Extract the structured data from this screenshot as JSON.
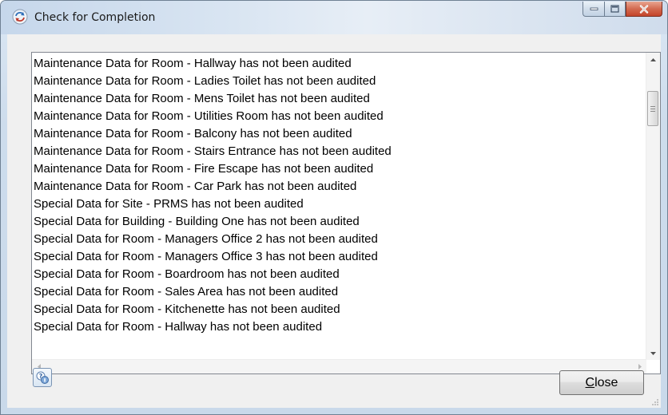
{
  "window": {
    "title": "Check for Completion",
    "title_icon": "refresh-cycle-icon",
    "caption_buttons": [
      "minimize-icon",
      "maximize-icon",
      "close-icon"
    ]
  },
  "messages": [
    "Maintenance Data for Room - Hallway has not been audited",
    "Maintenance Data for Room - Ladies Toilet has not been audited",
    "Maintenance Data for Room - Mens Toilet has not been audited",
    "Maintenance Data for Room - Utilities Room has not been audited",
    "Maintenance Data for Room - Balcony has not been audited",
    "Maintenance Data for Room - Stairs Entrance has not been audited",
    "Maintenance Data for Room - Fire Escape has not been audited",
    "Maintenance Data for Room - Car Park has not been audited",
    "Special Data for Site - PRMS has not been audited",
    "Special Data for Building - Building One has not been audited",
    "Special Data for Room - Managers Office 2 has not been audited",
    "Special Data for Room - Managers Office 3 has not been audited",
    "Special Data for Room - Boardroom has not been audited",
    "Special Data for Room - Sales Area has not been audited",
    "Special Data for Room - Kitchenette has not been audited",
    "Special Data for Room - Hallway has not been audited"
  ],
  "buttons": {
    "help_icon": "help-icon",
    "close_mnemonic": "C",
    "close_rest": "lose"
  },
  "colors": {
    "close_caption_red": "#c4442a",
    "titlebar_blue": "#cddcec"
  }
}
